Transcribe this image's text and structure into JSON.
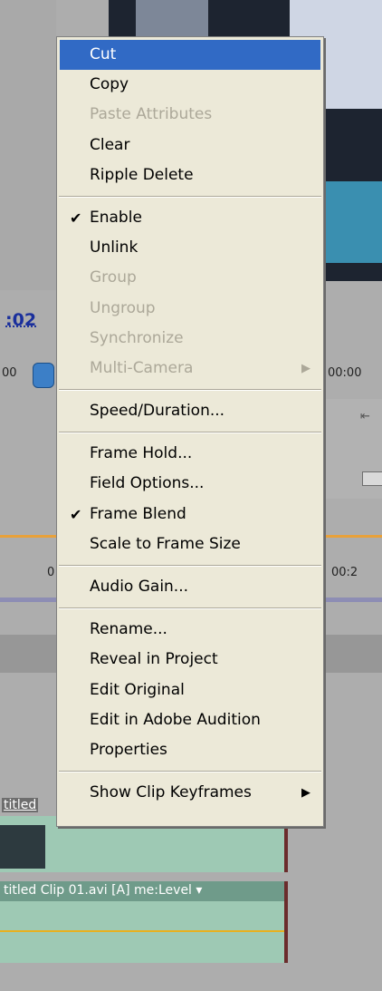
{
  "background": {
    "timecode": ":02",
    "timecode_left_small": "00",
    "timecode_right_1": "00:00",
    "ruler_tick_left": "0",
    "timecode_right_2": "00:2",
    "video_clip_label": "titled",
    "audio_clip_label": "titled Clip 01.avi [A]  me:Level ▾"
  },
  "menu": {
    "groups": [
      [
        {
          "label": "Cut",
          "state": "selected"
        },
        {
          "label": "Copy",
          "state": "normal"
        },
        {
          "label": "Paste Attributes",
          "state": "disabled"
        },
        {
          "label": "Clear",
          "state": "normal"
        },
        {
          "label": "Ripple Delete",
          "state": "normal"
        }
      ],
      [
        {
          "label": "Enable",
          "state": "normal",
          "checked": true
        },
        {
          "label": "Unlink",
          "state": "normal"
        },
        {
          "label": "Group",
          "state": "disabled"
        },
        {
          "label": "Ungroup",
          "state": "disabled"
        },
        {
          "label": "Synchronize",
          "state": "disabled"
        },
        {
          "label": "Multi-Camera",
          "state": "disabled",
          "submenu": true
        }
      ],
      [
        {
          "label": "Speed/Duration...",
          "state": "normal"
        }
      ],
      [
        {
          "label": "Frame Hold...",
          "state": "normal"
        },
        {
          "label": "Field Options...",
          "state": "normal"
        },
        {
          "label": "Frame Blend",
          "state": "normal",
          "checked": true
        },
        {
          "label": "Scale to Frame Size",
          "state": "normal"
        }
      ],
      [
        {
          "label": "Audio Gain...",
          "state": "normal"
        }
      ],
      [
        {
          "label": "Rename...",
          "state": "normal"
        },
        {
          "label": "Reveal in Project",
          "state": "normal"
        },
        {
          "label": "Edit Original",
          "state": "normal"
        },
        {
          "label": "Edit in Adobe Audition",
          "state": "normal"
        },
        {
          "label": "Properties",
          "state": "normal"
        }
      ],
      [
        {
          "label": "Show Clip Keyframes",
          "state": "normal",
          "submenu": true
        }
      ]
    ],
    "check_glyph": "✔",
    "arrow_glyph": "▶"
  },
  "colors": {
    "menu_bg": "#ece9d8",
    "selection": "#316ac5",
    "disabled_text": "#aca899"
  }
}
